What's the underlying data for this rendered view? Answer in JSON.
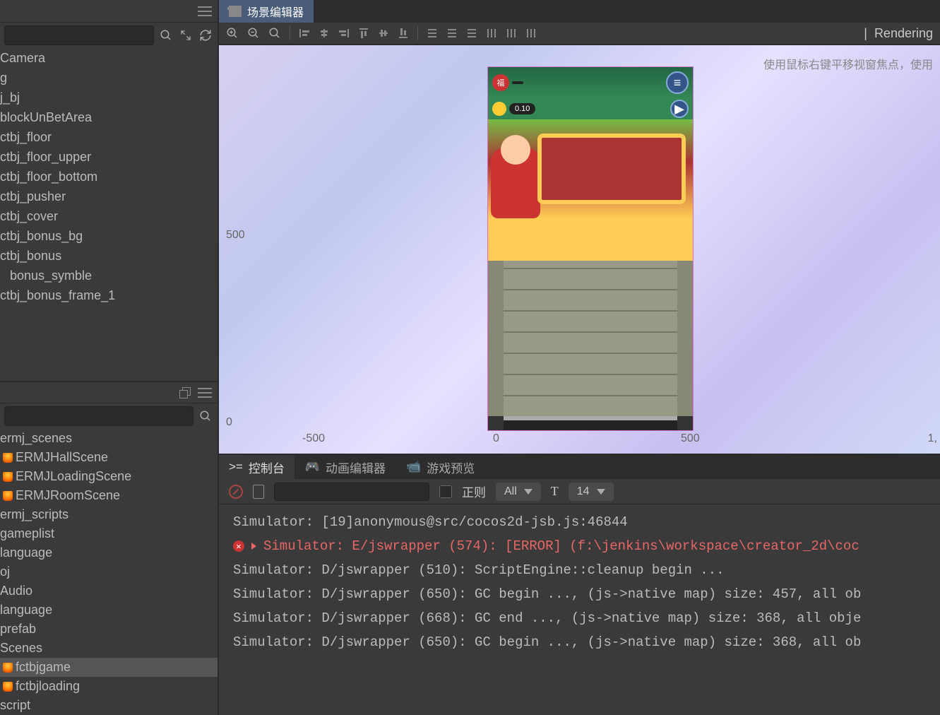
{
  "scene_tab": "场景编辑器",
  "rendering_label": "Rendering",
  "canvas_hint": "使用鼠标右键平移视窗焦点，使用",
  "hierarchy": {
    "items": [
      {
        "label": "Camera",
        "indent": false
      },
      {
        "label": "g",
        "indent": false
      },
      {
        "label": "j_bj",
        "indent": false
      },
      {
        "label": "blockUnBetArea",
        "indent": false
      },
      {
        "label": "ctbj_floor",
        "indent": false
      },
      {
        "label": "ctbj_floor_upper",
        "indent": false
      },
      {
        "label": "ctbj_floor_bottom",
        "indent": false
      },
      {
        "label": "ctbj_pusher",
        "indent": false
      },
      {
        "label": "ctbj_cover",
        "indent": false
      },
      {
        "label": "ctbj_bonus_bg",
        "indent": false
      },
      {
        "label": "ctbj_bonus",
        "indent": false
      },
      {
        "label": "bonus_symble",
        "indent": true
      },
      {
        "label": "ctbj_bonus_frame_1",
        "indent": false
      }
    ]
  },
  "assets": {
    "items": [
      {
        "label": "ermj_scenes",
        "icon": false,
        "selected": false
      },
      {
        "label": "ERMJHallScene",
        "icon": true,
        "selected": false
      },
      {
        "label": "ERMJLoadingScene",
        "icon": true,
        "selected": false
      },
      {
        "label": "ERMJRoomScene",
        "icon": true,
        "selected": false
      },
      {
        "label": "ermj_scripts",
        "icon": false,
        "selected": false
      },
      {
        "label": "gameplist",
        "icon": false,
        "selected": false
      },
      {
        "label": "language",
        "icon": false,
        "selected": false
      },
      {
        "label": "oj",
        "icon": false,
        "selected": false
      },
      {
        "label": "Audio",
        "icon": false,
        "selected": false
      },
      {
        "label": "language",
        "icon": false,
        "selected": false
      },
      {
        "label": "prefab",
        "icon": false,
        "selected": false
      },
      {
        "label": "Scenes",
        "icon": false,
        "selected": false
      },
      {
        "label": "fctbjgame",
        "icon": true,
        "selected": true
      },
      {
        "label": "fctbjloading",
        "icon": true,
        "selected": false
      },
      {
        "label": "script",
        "icon": false,
        "selected": false
      }
    ]
  },
  "rulers": {
    "y500": "500",
    "y0": "0",
    "xm500": "-500",
    "x0": "0",
    "x500": "500",
    "x1": "1,"
  },
  "bottom_tabs": {
    "console": "控制台",
    "anim": "动画编辑器",
    "preview": "游戏预览"
  },
  "console_toolbar": {
    "regex_label": "正则",
    "filter": "All",
    "fontsize": "14"
  },
  "console": {
    "lines": [
      {
        "type": "log",
        "text": "Simulator: [19]anonymous@src/cocos2d-jsb.js:46844"
      },
      {
        "type": "error",
        "text": "Simulator: E/jswrapper (574): [ERROR] (f:\\jenkins\\workspace\\creator_2d\\coc"
      },
      {
        "type": "log",
        "text": "Simulator: D/jswrapper (510): ScriptEngine::cleanup begin ..."
      },
      {
        "type": "log",
        "text": "Simulator: D/jswrapper (650): GC begin ..., (js->native map) size: 457, all ob"
      },
      {
        "type": "log",
        "text": "Simulator: D/jswrapper (668): GC end ..., (js->native map) size: 368, all obje"
      },
      {
        "type": "log",
        "text": "Simulator: D/jswrapper (650): GC begin ..., (js->native map) size: 368, all ob"
      }
    ]
  },
  "game": {
    "badge_label": "福",
    "coin_value": "0.10"
  }
}
